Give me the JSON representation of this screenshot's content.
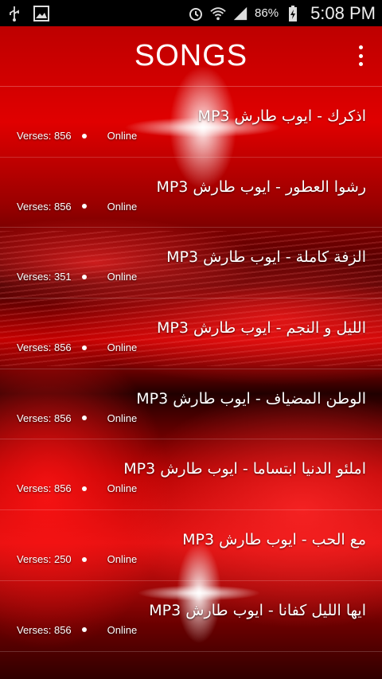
{
  "status_bar": {
    "icons_left": [
      "usb-icon",
      "image-icon"
    ],
    "icons_right": [
      "alarm-icon",
      "wifi-icon",
      "signal-icon",
      "battery-charging-icon"
    ],
    "battery": "86%",
    "time": "5:08 PM"
  },
  "action_bar": {
    "title": "SONGS",
    "menu_icon": "overflow-menu-icon"
  },
  "songs": [
    {
      "title": "اذكرك - ايوب طارش MP3",
      "verses": "Verses: 856",
      "status": "Online"
    },
    {
      "title": "رشوا العطور - ايوب طارش MP3",
      "verses": "Verses: 856",
      "status": "Online"
    },
    {
      "title": "الزفة كاملة - ايوب طارش MP3",
      "verses": "Verses: 351",
      "status": "Online"
    },
    {
      "title": "الليل و النجم - ايوب طارش MP3",
      "verses": "Verses: 856",
      "status": "Online"
    },
    {
      "title": "الوطن المضياف - ايوب طارش MP3",
      "verses": "Verses: 856",
      "status": "Online"
    },
    {
      "title": "املئو الدنيا ابتساما - ايوب طارش MP3",
      "verses": "Verses: 856",
      "status": "Online"
    },
    {
      "title": "مع الحب - ايوب طارش MP3",
      "verses": "Verses: 250",
      "status": "Online"
    },
    {
      "title": "ايها الليل كفانا - ايوب طارش MP3",
      "verses": "Verses: 856",
      "status": "Online"
    }
  ],
  "colors": {
    "accent": "#e00000",
    "text": "#ffffff"
  }
}
